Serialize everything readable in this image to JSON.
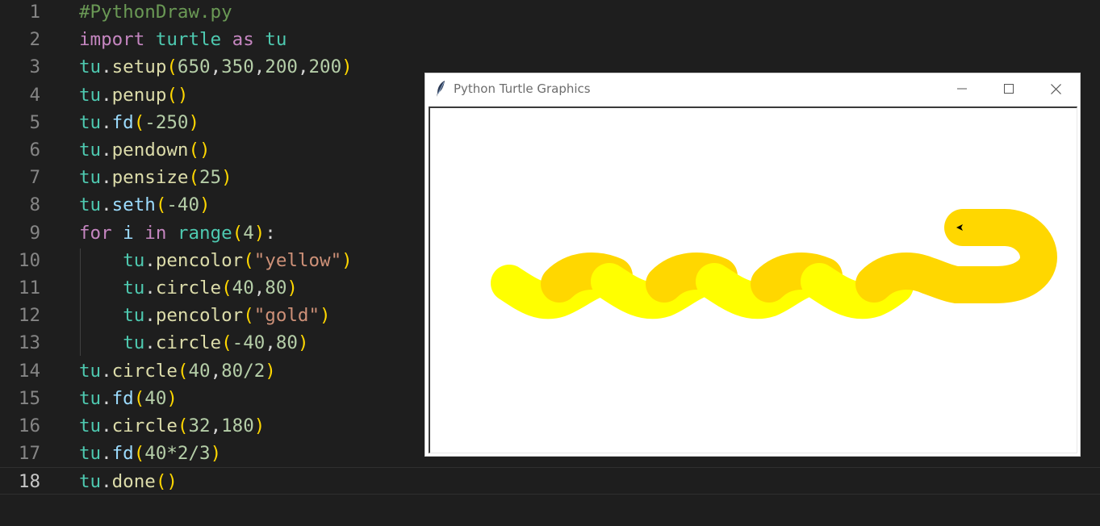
{
  "editor": {
    "current_line": 18,
    "lines": [
      [
        {
          "t": "#PythonDraw.py",
          "c": "#6a9955"
        }
      ],
      [
        {
          "t": "import",
          "c": "#c586c0"
        },
        {
          "t": " turtle ",
          "c": "#4ec9b0"
        },
        {
          "t": "as",
          "c": "#c586c0"
        },
        {
          "t": " tu",
          "c": "#4ec9b0"
        }
      ],
      [
        {
          "t": "tu",
          "c": "#4ec9b0"
        },
        {
          "t": ".",
          "c": "#d4d4d4"
        },
        {
          "t": "setup",
          "c": "#dcdcaa"
        },
        {
          "t": "(",
          "c": "#ffd700"
        },
        {
          "t": "650",
          "c": "#b5cea8"
        },
        {
          "t": ",",
          "c": "#d4d4d4"
        },
        {
          "t": "350",
          "c": "#b5cea8"
        },
        {
          "t": ",",
          "c": "#d4d4d4"
        },
        {
          "t": "200",
          "c": "#b5cea8"
        },
        {
          "t": ",",
          "c": "#d4d4d4"
        },
        {
          "t": "200",
          "c": "#b5cea8"
        },
        {
          "t": ")",
          "c": "#ffd700"
        }
      ],
      [
        {
          "t": "tu",
          "c": "#4ec9b0"
        },
        {
          "t": ".",
          "c": "#d4d4d4"
        },
        {
          "t": "penup",
          "c": "#dcdcaa"
        },
        {
          "t": "()",
          "c": "#ffd700"
        }
      ],
      [
        {
          "t": "tu",
          "c": "#4ec9b0"
        },
        {
          "t": ".",
          "c": "#d4d4d4"
        },
        {
          "t": "fd",
          "c": "#9cdcfe"
        },
        {
          "t": "(",
          "c": "#ffd700"
        },
        {
          "t": "-250",
          "c": "#b5cea8"
        },
        {
          "t": ")",
          "c": "#ffd700"
        }
      ],
      [
        {
          "t": "tu",
          "c": "#4ec9b0"
        },
        {
          "t": ".",
          "c": "#d4d4d4"
        },
        {
          "t": "pendown",
          "c": "#dcdcaa"
        },
        {
          "t": "()",
          "c": "#ffd700"
        }
      ],
      [
        {
          "t": "tu",
          "c": "#4ec9b0"
        },
        {
          "t": ".",
          "c": "#d4d4d4"
        },
        {
          "t": "pensize",
          "c": "#dcdcaa"
        },
        {
          "t": "(",
          "c": "#ffd700"
        },
        {
          "t": "25",
          "c": "#b5cea8"
        },
        {
          "t": ")",
          "c": "#ffd700"
        }
      ],
      [
        {
          "t": "tu",
          "c": "#4ec9b0"
        },
        {
          "t": ".",
          "c": "#d4d4d4"
        },
        {
          "t": "seth",
          "c": "#9cdcfe"
        },
        {
          "t": "(",
          "c": "#ffd700"
        },
        {
          "t": "-40",
          "c": "#b5cea8"
        },
        {
          "t": ")",
          "c": "#ffd700"
        }
      ],
      [
        {
          "t": "for",
          "c": "#c586c0"
        },
        {
          "t": " i ",
          "c": "#9cdcfe"
        },
        {
          "t": "in",
          "c": "#c586c0"
        },
        {
          "t": " ",
          "c": "#d4d4d4"
        },
        {
          "t": "range",
          "c": "#4ec9b0"
        },
        {
          "t": "(",
          "c": "#ffd700"
        },
        {
          "t": "4",
          "c": "#b5cea8"
        },
        {
          "t": ")",
          "c": "#ffd700"
        },
        {
          "t": ":",
          "c": "#d4d4d4"
        }
      ],
      [
        {
          "t": "    ",
          "c": "#d4d4d4"
        },
        {
          "t": "tu",
          "c": "#4ec9b0"
        },
        {
          "t": ".",
          "c": "#d4d4d4"
        },
        {
          "t": "pencolor",
          "c": "#dcdcaa"
        },
        {
          "t": "(",
          "c": "#ffd700"
        },
        {
          "t": "\"yellow\"",
          "c": "#ce9178"
        },
        {
          "t": ")",
          "c": "#ffd700"
        }
      ],
      [
        {
          "t": "    ",
          "c": "#d4d4d4"
        },
        {
          "t": "tu",
          "c": "#4ec9b0"
        },
        {
          "t": ".",
          "c": "#d4d4d4"
        },
        {
          "t": "circle",
          "c": "#dcdcaa"
        },
        {
          "t": "(",
          "c": "#ffd700"
        },
        {
          "t": "40",
          "c": "#b5cea8"
        },
        {
          "t": ",",
          "c": "#d4d4d4"
        },
        {
          "t": "80",
          "c": "#b5cea8"
        },
        {
          "t": ")",
          "c": "#ffd700"
        }
      ],
      [
        {
          "t": "    ",
          "c": "#d4d4d4"
        },
        {
          "t": "tu",
          "c": "#4ec9b0"
        },
        {
          "t": ".",
          "c": "#d4d4d4"
        },
        {
          "t": "pencolor",
          "c": "#dcdcaa"
        },
        {
          "t": "(",
          "c": "#ffd700"
        },
        {
          "t": "\"gold\"",
          "c": "#ce9178"
        },
        {
          "t": ")",
          "c": "#ffd700"
        }
      ],
      [
        {
          "t": "    ",
          "c": "#d4d4d4"
        },
        {
          "t": "tu",
          "c": "#4ec9b0"
        },
        {
          "t": ".",
          "c": "#d4d4d4"
        },
        {
          "t": "circle",
          "c": "#dcdcaa"
        },
        {
          "t": "(",
          "c": "#ffd700"
        },
        {
          "t": "-40",
          "c": "#b5cea8"
        },
        {
          "t": ",",
          "c": "#d4d4d4"
        },
        {
          "t": "80",
          "c": "#b5cea8"
        },
        {
          "t": ")",
          "c": "#ffd700"
        }
      ],
      [
        {
          "t": "tu",
          "c": "#4ec9b0"
        },
        {
          "t": ".",
          "c": "#d4d4d4"
        },
        {
          "t": "circle",
          "c": "#dcdcaa"
        },
        {
          "t": "(",
          "c": "#ffd700"
        },
        {
          "t": "40",
          "c": "#b5cea8"
        },
        {
          "t": ",",
          "c": "#d4d4d4"
        },
        {
          "t": "80/2",
          "c": "#b5cea8"
        },
        {
          "t": ")",
          "c": "#ffd700"
        }
      ],
      [
        {
          "t": "tu",
          "c": "#4ec9b0"
        },
        {
          "t": ".",
          "c": "#d4d4d4"
        },
        {
          "t": "fd",
          "c": "#9cdcfe"
        },
        {
          "t": "(",
          "c": "#ffd700"
        },
        {
          "t": "40",
          "c": "#b5cea8"
        },
        {
          "t": ")",
          "c": "#ffd700"
        }
      ],
      [
        {
          "t": "tu",
          "c": "#4ec9b0"
        },
        {
          "t": ".",
          "c": "#d4d4d4"
        },
        {
          "t": "circle",
          "c": "#dcdcaa"
        },
        {
          "t": "(",
          "c": "#ffd700"
        },
        {
          "t": "32",
          "c": "#b5cea8"
        },
        {
          "t": ",",
          "c": "#d4d4d4"
        },
        {
          "t": "180",
          "c": "#b5cea8"
        },
        {
          "t": ")",
          "c": "#ffd700"
        }
      ],
      [
        {
          "t": "tu",
          "c": "#4ec9b0"
        },
        {
          "t": ".",
          "c": "#d4d4d4"
        },
        {
          "t": "fd",
          "c": "#9cdcfe"
        },
        {
          "t": "(",
          "c": "#ffd700"
        },
        {
          "t": "40*2/3",
          "c": "#b5cea8"
        },
        {
          "t": ")",
          "c": "#ffd700"
        }
      ],
      [
        {
          "t": "tu",
          "c": "#4ec9b0"
        },
        {
          "t": ".",
          "c": "#d4d4d4"
        },
        {
          "t": "done",
          "c": "#dcdcaa"
        },
        {
          "t": "()",
          "c": "#ffd700"
        }
      ]
    ]
  },
  "turtle_window": {
    "title": "Python Turtle Graphics",
    "minimize_glyph": "—",
    "maximize_glyph": "☐",
    "close_glyph": "✕",
    "colors": {
      "yellow": "#ffff00",
      "gold": "#ffd700"
    }
  }
}
